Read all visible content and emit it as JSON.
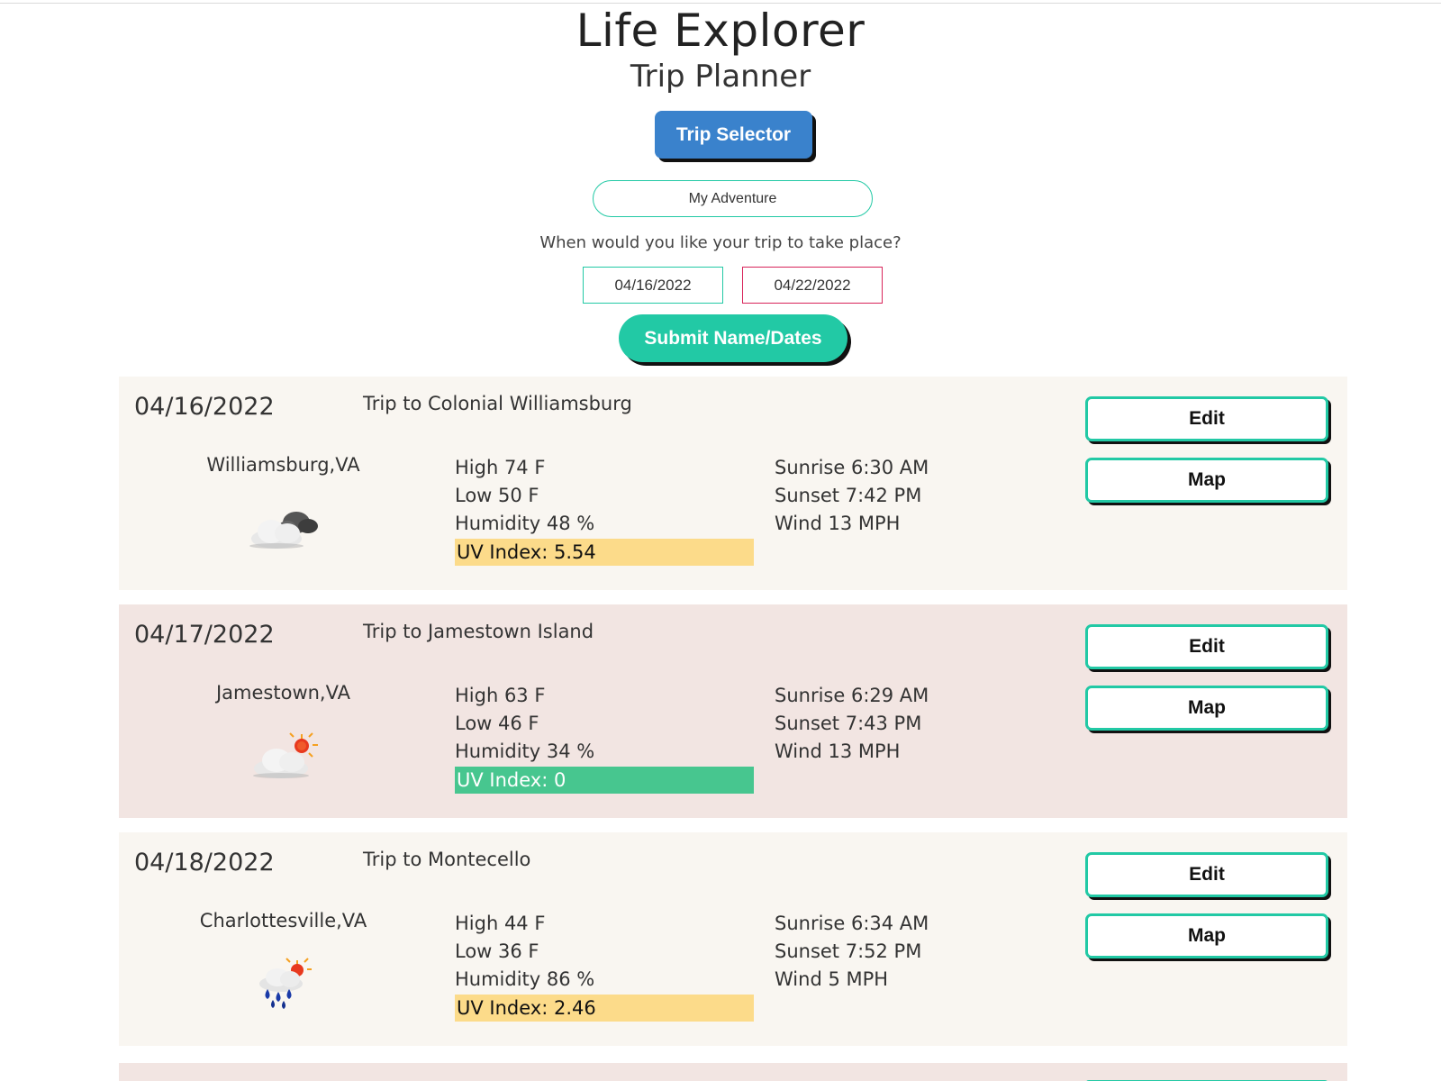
{
  "header": {
    "title": "Life Explorer",
    "subtitle": "Trip Planner"
  },
  "controls": {
    "trip_selector_label": "Trip Selector",
    "trip_name_value": "My Adventure",
    "date_question": "When would you like your trip to take place?",
    "start_date": "04/16/2022",
    "end_date": "04/22/2022",
    "submit_label": "Submit Name/Dates"
  },
  "colors": {
    "accent_teal": "#22c9a5",
    "selector_blue": "#3a82cc",
    "end_date_border": "#d8245a",
    "uv_moderate": "#fcdb8a",
    "uv_low": "#47c68f"
  },
  "days": [
    {
      "date": "04/16/2022",
      "trip": "Trip to Colonial Williamsburg",
      "city": "Williamsburg,VA",
      "weather_icon": "cloud-icon",
      "high": "High 74 F",
      "low": "Low 50 F",
      "humidity": "Humidity 48 %",
      "uv": "UV Index: 5.54",
      "uv_level": "moderate",
      "sunrise": "Sunrise 6:30 AM",
      "sunset": "Sunset 7:42 PM",
      "wind": "Wind 13 MPH",
      "edit_label": "Edit",
      "map_label": "Map"
    },
    {
      "date": "04/17/2022",
      "trip": "Trip to Jamestown Island",
      "city": "Jamestown,VA",
      "weather_icon": "partly-sunny-icon",
      "high": "High 63 F",
      "low": "Low 46 F",
      "humidity": "Humidity 34 %",
      "uv": "UV Index: 0",
      "uv_level": "low",
      "sunrise": "Sunrise 6:29 AM",
      "sunset": "Sunset 7:43 PM",
      "wind": "Wind 13 MPH",
      "edit_label": "Edit",
      "map_label": "Map"
    },
    {
      "date": "04/18/2022",
      "trip": "Trip to Montecello",
      "city": "Charlottesville,VA",
      "weather_icon": "rain-sun-icon",
      "high": "High 44 F",
      "low": "Low 36 F",
      "humidity": "Humidity 86 %",
      "uv": "UV Index: 2.46",
      "uv_level": "moderate",
      "sunrise": "Sunrise 6:34 AM",
      "sunset": "Sunset 7:52 PM",
      "wind": "Wind 5 MPH",
      "edit_label": "Edit",
      "map_label": "Map"
    }
  ]
}
